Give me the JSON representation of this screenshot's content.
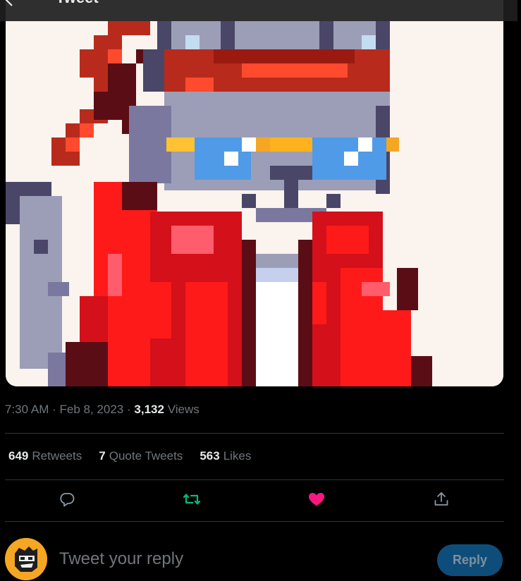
{
  "header": {
    "title": "Tweet",
    "back_icon": "arrow-left-icon"
  },
  "media": {
    "alt": ""
  },
  "meta": {
    "time": "7:30 AM",
    "sep1": "·",
    "date": "Feb 8, 2023",
    "sep2": "·",
    "views_count": "3,132",
    "views_label": "Views"
  },
  "stats": {
    "retweets_count": "649",
    "retweets_label": "Retweets",
    "quotes_count": "7",
    "quotes_label": "Quote Tweets",
    "likes_count": "563",
    "likes_label": "Likes"
  },
  "actions": {
    "reply_icon": "comment-icon",
    "retweet_icon": "retweet-icon",
    "like_icon": "heart-icon",
    "share_icon": "share-icon",
    "retweet_color": "#00ba7c",
    "like_color": "#f91880"
  },
  "compose": {
    "placeholder": "Tweet your reply",
    "reply_label": "Reply",
    "reply_button_color": "#0e4d7a"
  }
}
